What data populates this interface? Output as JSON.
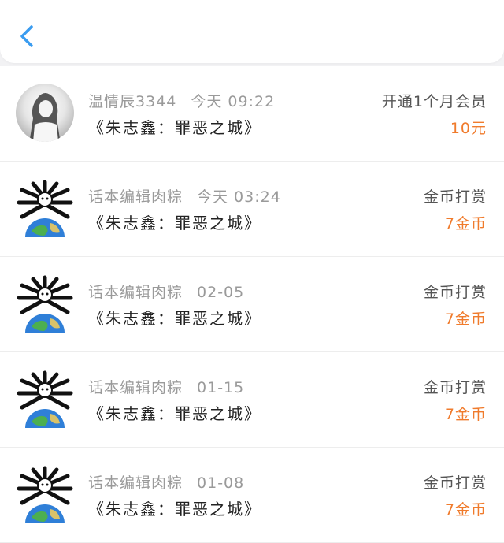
{
  "colors": {
    "accent_blue": "#3a9cf0",
    "amount_orange": "#f07b2c",
    "secondary_text": "#9a9a9a"
  },
  "header": {
    "back_icon": "chevron-left-icon"
  },
  "records": [
    {
      "user": "温情辰3344",
      "time": "今天 09:22",
      "book": "《朱志鑫：罪恶之城》",
      "type": "开通1个月会员",
      "amount": "10元",
      "avatar": "photo"
    },
    {
      "user": "话本编辑肉粽",
      "time": "今天 03:24",
      "book": "《朱志鑫：罪恶之城》",
      "type": "金币打赏",
      "amount": "7金币",
      "avatar": "emoji-earth"
    },
    {
      "user": "话本编辑肉粽",
      "time": "02-05",
      "book": "《朱志鑫：罪恶之城》",
      "type": "金币打赏",
      "amount": "7金币",
      "avatar": "emoji-earth"
    },
    {
      "user": "话本编辑肉粽",
      "time": "01-15",
      "book": "《朱志鑫：罪恶之城》",
      "type": "金币打赏",
      "amount": "7金币",
      "avatar": "emoji-earth"
    },
    {
      "user": "话本编辑肉粽",
      "time": "01-08",
      "book": "《朱志鑫：罪恶之城》",
      "type": "金币打赏",
      "amount": "7金币",
      "avatar": "emoji-earth"
    }
  ]
}
